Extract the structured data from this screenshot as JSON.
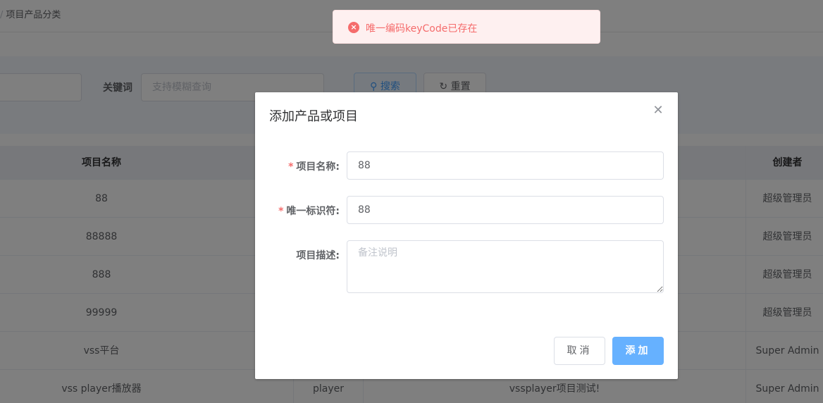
{
  "breadcrumb": {
    "separator": "/",
    "current": "项目产品分类"
  },
  "search": {
    "keyword_label": "关键词",
    "keyword_placeholder": "支持模糊查询",
    "search_button": "搜索",
    "reset_button": "重置"
  },
  "table": {
    "headers": {
      "name": "项目名称",
      "creator": "创建者"
    },
    "rows": [
      {
        "name": "88",
        "key": "",
        "desc": "",
        "creator": "超级管理员"
      },
      {
        "name": "88888",
        "key": "",
        "desc": "",
        "creator": "超级管理员"
      },
      {
        "name": "888",
        "key": "",
        "desc": "",
        "creator": "超级管理员"
      },
      {
        "name": "99999",
        "key": "",
        "desc": "",
        "creator": "超级管理员"
      },
      {
        "name": "vss平台",
        "key": "",
        "desc": "",
        "creator": "Super Admin"
      },
      {
        "name": "vss player播放器",
        "key": "player",
        "desc": "vssplayer项目测试!",
        "creator": "Super Admin"
      }
    ]
  },
  "dialog": {
    "title": "添加产品或项目",
    "close_icon": "close-icon",
    "fields": {
      "name_label": "项目名称:",
      "name_value": "88",
      "key_label": "唯一标识符:",
      "key_value": "88",
      "desc_label": "项目描述:",
      "desc_placeholder": "备注说明",
      "required_mark": "*"
    },
    "cancel_button": "取消",
    "add_button": "添加"
  },
  "toast": {
    "icon": "error-circle-icon",
    "message": "唯一编码keyCode已存在"
  },
  "colors": {
    "primary": "#409eff",
    "primary_light": "#66b1ff",
    "danger": "#f56c6c",
    "toast_bg": "#fef0f0"
  }
}
